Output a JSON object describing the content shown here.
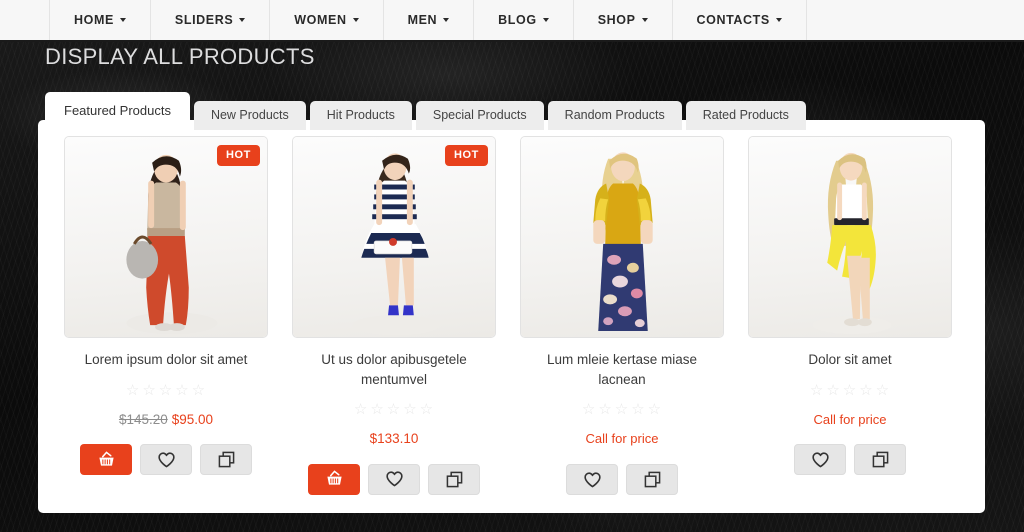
{
  "nav": {
    "items": [
      {
        "label": "HOME",
        "has_dropdown": true
      },
      {
        "label": "SLIDERS",
        "has_dropdown": true
      },
      {
        "label": "WOMEN",
        "has_dropdown": true
      },
      {
        "label": "MEN",
        "has_dropdown": true
      },
      {
        "label": "BLOG",
        "has_dropdown": true
      },
      {
        "label": "SHOP",
        "has_dropdown": true
      },
      {
        "label": "CONTACTS",
        "has_dropdown": true
      }
    ]
  },
  "page": {
    "title": "DISPLAY ALL PRODUCTS"
  },
  "tabs": [
    {
      "label": "Featured Products",
      "active": true
    },
    {
      "label": "New Products",
      "active": false
    },
    {
      "label": "Hit Products",
      "active": false
    },
    {
      "label": "Special Products",
      "active": false
    },
    {
      "label": "Random Products",
      "active": false
    },
    {
      "label": "Rated Products",
      "active": false
    }
  ],
  "products": [
    {
      "title": "Lorem ipsum dolor sit amet",
      "badge": "HOT",
      "rating": 0,
      "rating_max": 5,
      "old_price": "$145.20",
      "price": "$95.00",
      "price_mode": "sale",
      "buttons": [
        "add-to-cart",
        "wishlist",
        "compare"
      ],
      "image_alt": "Model in beige tank top and red trousers with silver handbag"
    },
    {
      "title": "Ut us dolor apibusgetele mentumvel",
      "badge": "HOT",
      "rating": 0,
      "rating_max": 5,
      "old_price": "",
      "price": "$133.10",
      "price_mode": "regular",
      "buttons": [
        "add-to-cart",
        "wishlist",
        "compare"
      ],
      "image_alt": "Model in navy and white striped dress with blue heels"
    },
    {
      "title": "Lum mleie kertase miase lacnean",
      "badge": "",
      "rating": 0,
      "rating_max": 5,
      "old_price": "",
      "price": "Call for price",
      "price_mode": "call",
      "buttons": [
        "wishlist",
        "compare"
      ],
      "image_alt": "Model in mustard yellow bolero top and floral print trousers"
    },
    {
      "title": "Dolor sit amet",
      "badge": "",
      "rating": 0,
      "rating_max": 5,
      "old_price": "",
      "price": "Call for price",
      "price_mode": "call",
      "buttons": [
        "wishlist",
        "compare"
      ],
      "image_alt": "Model in white tank top, black belt and yellow high-low skirt"
    }
  ],
  "icons": {
    "cart": "shopping-basket-icon",
    "wishlist": "heart-icon",
    "compare": "copy-squares-icon",
    "caret": "chevron-down-icon",
    "star": "star-outline-icon"
  },
  "colors": {
    "accent": "#e8411c",
    "panel": "#ffffff",
    "nav_bg": "#f7f7f7",
    "tab_inactive": "#ededed",
    "title_text": "#ddddde",
    "star_empty": "#e8e8e8",
    "old_price": "#8d8d8d"
  }
}
